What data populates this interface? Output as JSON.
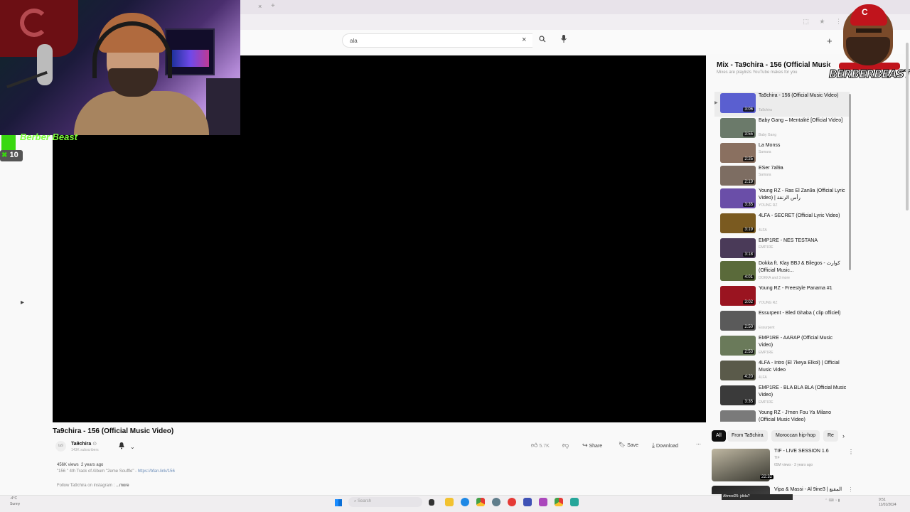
{
  "browser": {
    "tab_close": "×",
    "tab_new": "+",
    "ext_icons": "⬚ ★ ⋮"
  },
  "search": {
    "query": "ala",
    "clear": "×",
    "search_icon": "search-icon",
    "mic_icon": "mic-icon",
    "create_icon": "plus-icon",
    "create": "+"
  },
  "stream_overlay": {
    "name": "Berber Beast",
    "sub_count": "10",
    "logo_text": "BERBERBEAST",
    "logo_letter": "C"
  },
  "mix": {
    "title": "Mix - Ta9chira - 156 (Official Music...",
    "subtitle": "Mixes are playlists YouTube makes for you",
    "items": [
      {
        "title": "Ta9chira - 156 (Official Music Video)",
        "channel": "Ta9chira",
        "duration": "3:06",
        "thumb": "#5a5fd0",
        "active": true
      },
      {
        "title": "Baby Gang – Mentalité [Official Video]",
        "channel": "Baby Gang",
        "duration": "3:55",
        "thumb": "#6b7a6a"
      },
      {
        "title": "La Monss",
        "channel": "Samara",
        "duration": "2:25",
        "thumb": "#8a7060"
      },
      {
        "title": "ESer 7al9a",
        "channel": "Samara",
        "duration": "2:19",
        "thumb": "#7d6d62"
      },
      {
        "title": "Young RZ - Ras El Zan9a (Official Lyric Video) | رأس الزنقة",
        "channel": "YOUNG RZ",
        "duration": "3:35",
        "thumb": "#6a4ea8"
      },
      {
        "title": "4LFA - SECRET (Official Lyric Video)",
        "channel": "4LFA",
        "duration": "3:19",
        "thumb": "#7a5a20"
      },
      {
        "title": "EMP1RE - NES TESTANA",
        "channel": "EMP1RE",
        "duration": "3:18",
        "thumb": "#4a3a58"
      },
      {
        "title": "Dokka ft. Klay BBJ & Bilegos - كوارث (Official Music...",
        "channel": "DOKKA and 3 more",
        "duration": "4:01",
        "thumb": "#5a6a3a"
      },
      {
        "title": "Young RZ - Freestyle Panama #1",
        "channel": "YOUNG RZ",
        "duration": "3:02",
        "thumb": "#9a1420"
      },
      {
        "title": "Essurpent - Bled Ghaba ( clip officiel)",
        "channel": "Essurpent",
        "duration": "2:50",
        "thumb": "#5a5a5a"
      },
      {
        "title": "EMP1RE - AARAP (Official Music Video)",
        "channel": "EMP1RE",
        "duration": "2:53",
        "thumb": "#6a7a5a"
      },
      {
        "title": "4LFA - Intro (El 7keya Elkol) | Official Music Video",
        "channel": "4LFA",
        "duration": "4:20",
        "thumb": "#5a5a4a"
      },
      {
        "title": "EMP1RE - BLA BLA BLA (Official Music Video)",
        "channel": "EMP1RE",
        "duration": "3:35",
        "thumb": "#3a3a3a"
      },
      {
        "title": "Young RZ - J'men Fou Ya Milano (Official Music Video)",
        "channel": "YOUNG RZ",
        "duration": "",
        "thumb": "#7a7a7a"
      }
    ]
  },
  "video": {
    "title": "Ta9chira - 156 (Official Music Video)",
    "channel": "Ta9chira",
    "verified": "⊙",
    "subscribers": "143K subscribers",
    "avatar_text": "ta9",
    "likes": "5.7K",
    "share": "Share",
    "save": "Save",
    "download": "Download",
    "more": "⋯",
    "views": "456K views",
    "age": "2 years ago",
    "desc_line1": "\"156 \" 4th Track of Album \"2eme Souffle\" -",
    "desc_link": "https://bfan.link/156",
    "desc_line2": "Follow Ta9chira on instagram :",
    "desc_more": "...more"
  },
  "chips": [
    "All",
    "From Ta9chira",
    "Moroccan hip-hop",
    "Re"
  ],
  "recommendations": [
    {
      "title": "TIF - LIVE SESSION 1.6",
      "channel": "TIF",
      "meta": "65M views · 3 years ago",
      "duration": "22:32"
    },
    {
      "title": "Vipa & Massi - Al 9ine3 | المقنع",
      "channel": "",
      "meta": "",
      "duration": ""
    }
  ],
  "taskbar": {
    "weather_temp": "-4°C",
    "weather_desc": "Sunny",
    "search": "Search",
    "alert": "Ahmed25: jdida?",
    "clock_time": "9:51",
    "clock_date": "11/01/2024"
  },
  "colors": {
    "overlay_green": "#39d80f",
    "brand_red": "#c0141c",
    "player_bg": "#000000"
  }
}
